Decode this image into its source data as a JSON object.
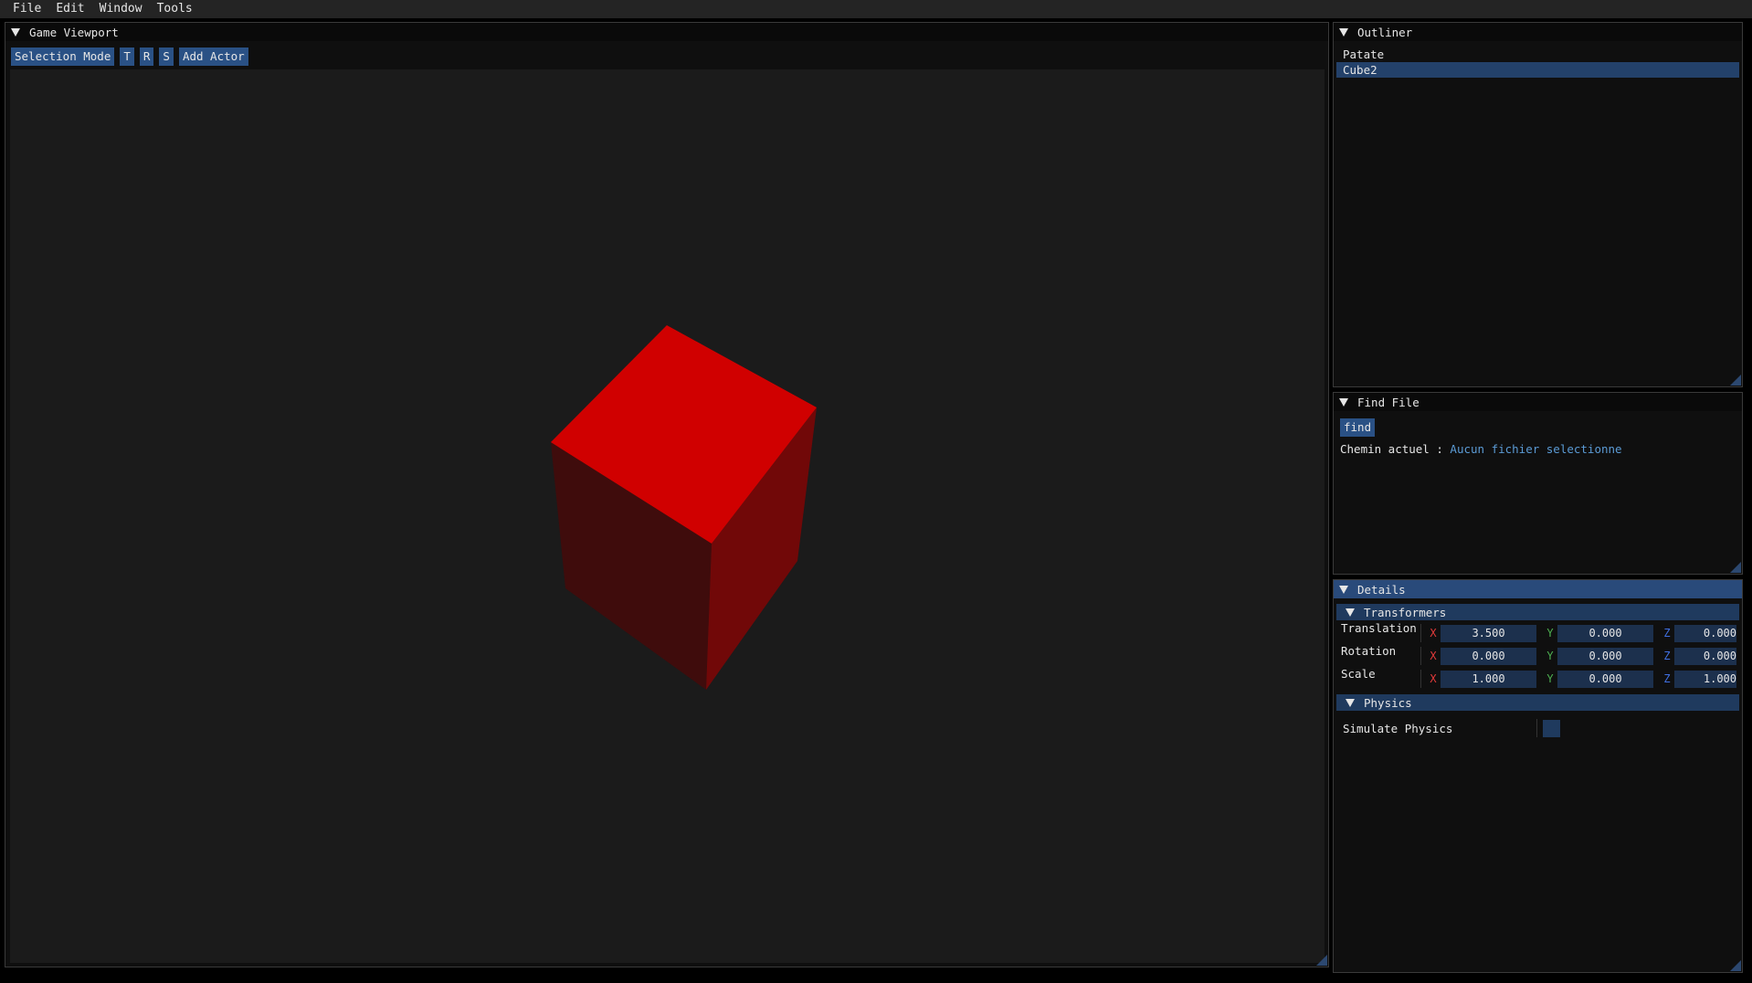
{
  "menubar": {
    "items": [
      "File",
      "Edit",
      "Window",
      "Tools"
    ]
  },
  "viewport": {
    "title": "Game Viewport",
    "toolbar": {
      "selection_mode": "Selection Mode",
      "t": "T",
      "r": "R",
      "s": "S",
      "add_actor": "Add Actor"
    },
    "cube": {
      "top_color": "#d00000",
      "left_color": "#3f0c0c",
      "right_color": "#710808"
    }
  },
  "outliner": {
    "title": "Outliner",
    "items": [
      "Patate",
      "Cube2"
    ],
    "selected": "Cube2"
  },
  "find_file": {
    "title": "Find File",
    "find_button": "find",
    "path_label": "Chemin actuel :",
    "path_value": "Aucun fichier selectionne"
  },
  "details": {
    "title": "Details",
    "transformers": {
      "title": "Transformers",
      "axes": [
        "X",
        "Y",
        "Z"
      ],
      "rows": [
        {
          "label": "Translation",
          "x": "3.500",
          "y": "0.000",
          "z": "0.000"
        },
        {
          "label": "Rotation",
          "x": "0.000",
          "y": "0.000",
          "z": "0.000"
        },
        {
          "label": "Scale",
          "x": "1.000",
          "y": "0.000",
          "z": "1.000"
        }
      ]
    },
    "physics": {
      "title": "Physics",
      "simulate_label": "Simulate Physics",
      "simulate_checked": false
    }
  },
  "colors": {
    "accent": "#2a5185",
    "active_title": "#294a7a",
    "viewport_bg": "#1b1b1b"
  }
}
